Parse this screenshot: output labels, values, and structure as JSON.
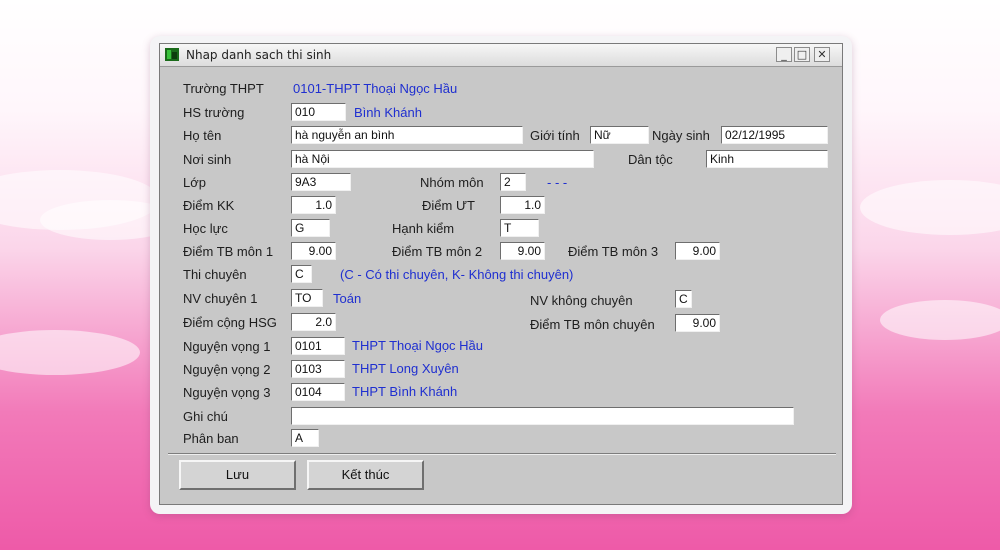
{
  "window": {
    "title": "Nhap danh sach thi sinh",
    "minimize_glyph": "_",
    "maximize_glyph": "□",
    "close_glyph": "✕"
  },
  "form": {
    "truong_thpt": {
      "label": "Trường THPT",
      "value": "0101-THPT Thoại Ngọc Hầu"
    },
    "hs_truong": {
      "label": "HS trường",
      "code": "010",
      "name": "Bình Khánh"
    },
    "ho_ten": {
      "label": "Họ tên",
      "value": "hà nguyễn an bình"
    },
    "gioi_tinh": {
      "label": "Giới tính",
      "value": "Nữ"
    },
    "ngay_sinh": {
      "label": "Ngày sinh",
      "value": "02/12/1995"
    },
    "noi_sinh": {
      "label": "Nơi sinh",
      "value": "hà Nội"
    },
    "dan_toc": {
      "label": "Dân tộc",
      "value": "Kinh"
    },
    "lop": {
      "label": "Lớp",
      "value": "9A3"
    },
    "nhom_mon": {
      "label": "Nhóm môn",
      "value": "2",
      "note": "- - -"
    },
    "diem_kk": {
      "label": "Điểm KK",
      "value": "1.0"
    },
    "diem_ut": {
      "label": "Điểm ƯT",
      "value": "1.0"
    },
    "hoc_luc": {
      "label": "Học lực",
      "value": "G"
    },
    "hanh_kiem": {
      "label": "Hạnh kiểm",
      "value": "T"
    },
    "diem_tb_mon_1": {
      "label": "Điểm TB môn 1",
      "value": "9.00"
    },
    "diem_tb_mon_2": {
      "label": "Điểm TB môn 2",
      "value": "9.00"
    },
    "diem_tb_mon_3": {
      "label": "Điểm TB môn 3",
      "value": "9.00"
    },
    "thi_chuyen": {
      "label": "Thi chuyên",
      "value": "C",
      "hint": "(C - Có thi chuyên, K- Không thi chuyên)"
    },
    "nv_chuyen_1": {
      "label": "NV chuyên 1",
      "code": "TO",
      "name": "Toán"
    },
    "nv_khong_chuyen": {
      "label": "NV không chuyên",
      "value": "C"
    },
    "diem_cong_hsg": {
      "label": "Điểm cộng HSG",
      "value": "2.0"
    },
    "diem_tb_mon_chuyen": {
      "label": "Điểm TB môn chuyên",
      "value": "9.00"
    },
    "nguyen_vong_1": {
      "label": "Nguyện vọng 1",
      "code": "0101",
      "name": "THPT Thoại Ngọc Hầu"
    },
    "nguyen_vong_2": {
      "label": "Nguyện vọng 2",
      "code": "0103",
      "name": "THPT Long Xuyên"
    },
    "nguyen_vong_3": {
      "label": "Nguyện vọng 3",
      "code": "0104",
      "name": "THPT Bình Khánh"
    },
    "ghi_chu": {
      "label": "Ghi chú",
      "value": ""
    },
    "phan_ban": {
      "label": "Phân ban",
      "value": "A"
    }
  },
  "buttons": {
    "save": "Lưu",
    "finish": "Kết thúc"
  },
  "colors": {
    "window_bg": "#c8c8c8",
    "link_blue": "#1f2fd0",
    "background_pink": "#ee5aa8"
  }
}
